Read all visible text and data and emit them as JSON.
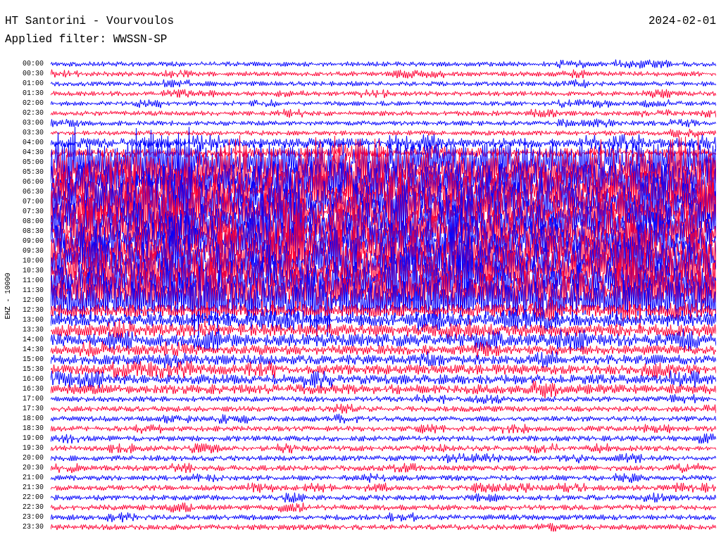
{
  "header": {
    "station": "HT Santorini - Vourvoulos",
    "date": "2024-02-01",
    "filter": "Applied filter: WWSSN-SP"
  },
  "channel_label": "EHZ - 10000",
  "rows": [
    {
      "time": "00:00"
    },
    {
      "time": "00:30"
    },
    {
      "time": "01:00"
    },
    {
      "time": "01:30"
    },
    {
      "time": "02:00"
    },
    {
      "time": "02:30"
    },
    {
      "time": "03:00"
    },
    {
      "time": "03:30"
    },
    {
      "time": "04:00"
    },
    {
      "time": "04:30"
    },
    {
      "time": "05:00"
    },
    {
      "time": "05:30"
    },
    {
      "time": "06:00"
    },
    {
      "time": "06:30"
    },
    {
      "time": "07:00"
    },
    {
      "time": "07:30"
    },
    {
      "time": "08:00"
    },
    {
      "time": "08:30"
    },
    {
      "time": "09:00"
    },
    {
      "time": "09:30"
    },
    {
      "time": "10:00"
    },
    {
      "time": "10:30"
    },
    {
      "time": "11:00"
    },
    {
      "time": "11:30"
    },
    {
      "time": "12:00"
    },
    {
      "time": "12:30"
    },
    {
      "time": "13:00"
    },
    {
      "time": "13:30"
    },
    {
      "time": "14:00"
    },
    {
      "time": "14:30"
    },
    {
      "time": "15:00"
    },
    {
      "time": "15:30"
    },
    {
      "time": "16:00"
    },
    {
      "time": "16:30"
    },
    {
      "time": "17:00"
    },
    {
      "time": "17:30"
    },
    {
      "time": "18:00"
    },
    {
      "time": "18:30"
    },
    {
      "time": "19:00"
    },
    {
      "time": "19:30"
    },
    {
      "time": "20:00"
    },
    {
      "time": "20:30"
    },
    {
      "time": "21:00"
    },
    {
      "time": "21:30"
    },
    {
      "time": "22:00"
    },
    {
      "time": "22:30"
    },
    {
      "time": "23:00"
    },
    {
      "time": "23:30"
    }
  ]
}
